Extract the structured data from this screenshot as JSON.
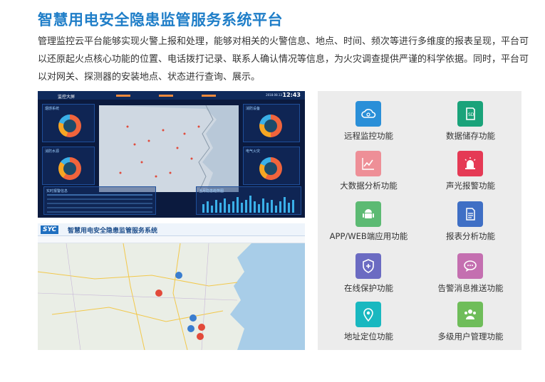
{
  "title": "智慧用电安全隐患监管服务系统平台",
  "description": "管理监控云平台能够实现火警上报和处理，能够对相关的火警信息、地点、时间、频次等进行多维度的报表呈现，平台可以还原起火点核心功能的位置、电话拨打记录、联系人确认情况等信息，为火灾调查提供严谨的科学依据。同时，平台可以对网关、探测器的安装地点、状态进行查询、展示。",
  "dashboard": {
    "header_title": "监控大屏",
    "time": "12:43",
    "date": "2018.08.13",
    "panels": [
      "烟感系统",
      "消防设备",
      "消防水源",
      "电气火灾"
    ],
    "table_title": "实时报警信息",
    "chart_title": "当月隐患趋势图"
  },
  "mapshot": {
    "logo": "SYC",
    "title": "智慧用电安全隐患监管服务系统"
  },
  "features": [
    {
      "label": "远程监控功能",
      "icon": "cloud-settings-icon",
      "color": "#2a8fd8"
    },
    {
      "label": "数据储存功能",
      "icon": "sd-card-icon",
      "color": "#1aa37a"
    },
    {
      "label": "大数据分析功能",
      "icon": "line-chart-icon",
      "color": "#ee8f97"
    },
    {
      "label": "声光报警功能",
      "icon": "alarm-light-icon",
      "color": "#e53a55"
    },
    {
      "label": "APP/WEB端应用功能",
      "icon": "android-icon",
      "color": "#5cba73"
    },
    {
      "label": "报表分析功能",
      "icon": "report-icon",
      "color": "#3f6fc5"
    },
    {
      "label": "在线保护功能",
      "icon": "shield-plus-icon",
      "color": "#6b6bc2"
    },
    {
      "label": "告警消息推送功能",
      "icon": "message-icon",
      "color": "#c46fb0"
    },
    {
      "label": "地址定位功能",
      "icon": "location-pin-icon",
      "color": "#19b8c0"
    },
    {
      "label": "多级用户管理功能",
      "icon": "users-icon",
      "color": "#6fbd5a"
    }
  ]
}
